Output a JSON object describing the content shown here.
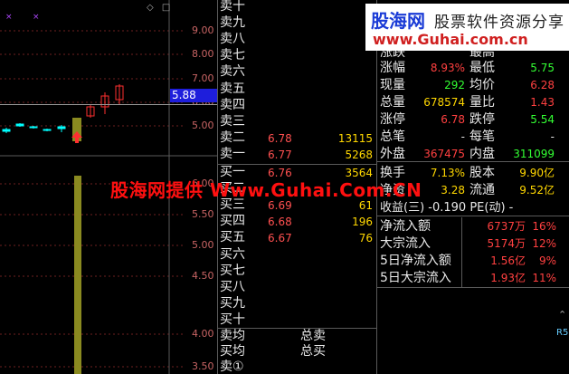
{
  "chart": {
    "ticks_top": [
      "9.00",
      "8.00",
      "7.00",
      "6.00",
      "5.00"
    ],
    "ticks_bottom": [
      "6.00",
      "5.50",
      "5.00",
      "4.50",
      "4.00",
      "3.50"
    ],
    "price_tag": "5.88",
    "colors": {
      "up": "#ff3030",
      "down": "#00ffff",
      "volume": "#8a8a20",
      "grid": "#6e2020",
      "price_tag_bg": "#1e1edc"
    }
  },
  "orderbook": {
    "sell": [
      {
        "label": "卖十",
        "price": "",
        "vol": ""
      },
      {
        "label": "卖九",
        "price": "",
        "vol": ""
      },
      {
        "label": "卖八",
        "price": "",
        "vol": ""
      },
      {
        "label": "卖七",
        "price": "",
        "vol": ""
      },
      {
        "label": "卖六",
        "price": "",
        "vol": ""
      },
      {
        "label": "卖五",
        "price": "",
        "vol": ""
      },
      {
        "label": "卖四",
        "price": "",
        "vol": ""
      },
      {
        "label": "卖三",
        "price": "",
        "vol": ""
      },
      {
        "label": "卖二",
        "price": "6.78",
        "vol": "13115"
      },
      {
        "label": "卖一",
        "price": "6.77",
        "vol": "5268"
      }
    ],
    "buy": [
      {
        "label": "买一",
        "price": "6.76",
        "vol": "3564"
      },
      {
        "label": "买二",
        "price": "",
        "vol": ""
      },
      {
        "label": "买三",
        "price": "6.69",
        "vol": "61"
      },
      {
        "label": "买四",
        "price": "6.68",
        "vol": "196"
      },
      {
        "label": "买五",
        "price": "6.67",
        "vol": "76"
      },
      {
        "label": "买六",
        "price": "",
        "vol": ""
      },
      {
        "label": "买七",
        "price": "",
        "vol": ""
      },
      {
        "label": "买八",
        "price": "",
        "vol": ""
      },
      {
        "label": "买九",
        "price": "",
        "vol": ""
      },
      {
        "label": "买十",
        "price": "",
        "vol": ""
      }
    ],
    "bottom": {
      "sell_avg": "卖均",
      "total_sell": "总卖",
      "buy_avg": "买均",
      "total_buy": "总买",
      "sell_one": "卖①"
    }
  },
  "quote": {
    "partial_top": "涨跌",
    "partial_mid": "最高",
    "rows": [
      {
        "l1": "涨幅",
        "v1": "8.93%",
        "c1": "red",
        "l2": "最低",
        "v2": "5.75",
        "c2": "green"
      },
      {
        "l1": "现量",
        "v1": "292",
        "c1": "green",
        "l2": "均价",
        "v2": "6.28",
        "c2": "red"
      },
      {
        "l1": "总量",
        "v1": "678574",
        "c1": "yellow",
        "l2": "量比",
        "v2": "1.43",
        "c2": "red"
      },
      {
        "l1": "涨停",
        "v1": "6.78",
        "c1": "red",
        "l2": "跌停",
        "v2": "5.54",
        "c2": "green"
      },
      {
        "l1": "总笔",
        "v1": "-",
        "c1": "white",
        "l2": "每笔",
        "v2": "-",
        "c2": "white"
      },
      {
        "l1": "外盘",
        "v1": "367475",
        "c1": "red",
        "l2": "内盘",
        "v2": "311099",
        "c2": "green"
      }
    ],
    "rows2": [
      {
        "l1": "换手",
        "v1": "7.13%",
        "c1": "yellow",
        "l2": "股本",
        "v2": "9.90亿",
        "c2": "yellow"
      },
      {
        "l1": "净资",
        "v1": "3.28",
        "c1": "yellow",
        "l2": "流通",
        "v2": "9.52亿",
        "c2": "yellow"
      }
    ],
    "earnings": "收益(三) -0.190 PE(动) -",
    "flows": [
      {
        "label": "净流入额",
        "val": "6737万",
        "pct": "16%"
      },
      {
        "label": "大宗流入",
        "val": "5174万",
        "pct": "12%"
      },
      {
        "label": "5日净流入额",
        "val": "1.56亿",
        "pct": "9%"
      },
      {
        "label": "5日大宗流入",
        "val": "1.93亿",
        "pct": "11%"
      }
    ],
    "edge_glyphs": [
      "⌃",
      "R5"
    ]
  },
  "watermark": {
    "logo": "股海网",
    "slogan": "股票软件资源分享",
    "url": "www.Guhai.com.cn",
    "overlay": "股海网提供 Www.Guhai.Com.CN"
  }
}
